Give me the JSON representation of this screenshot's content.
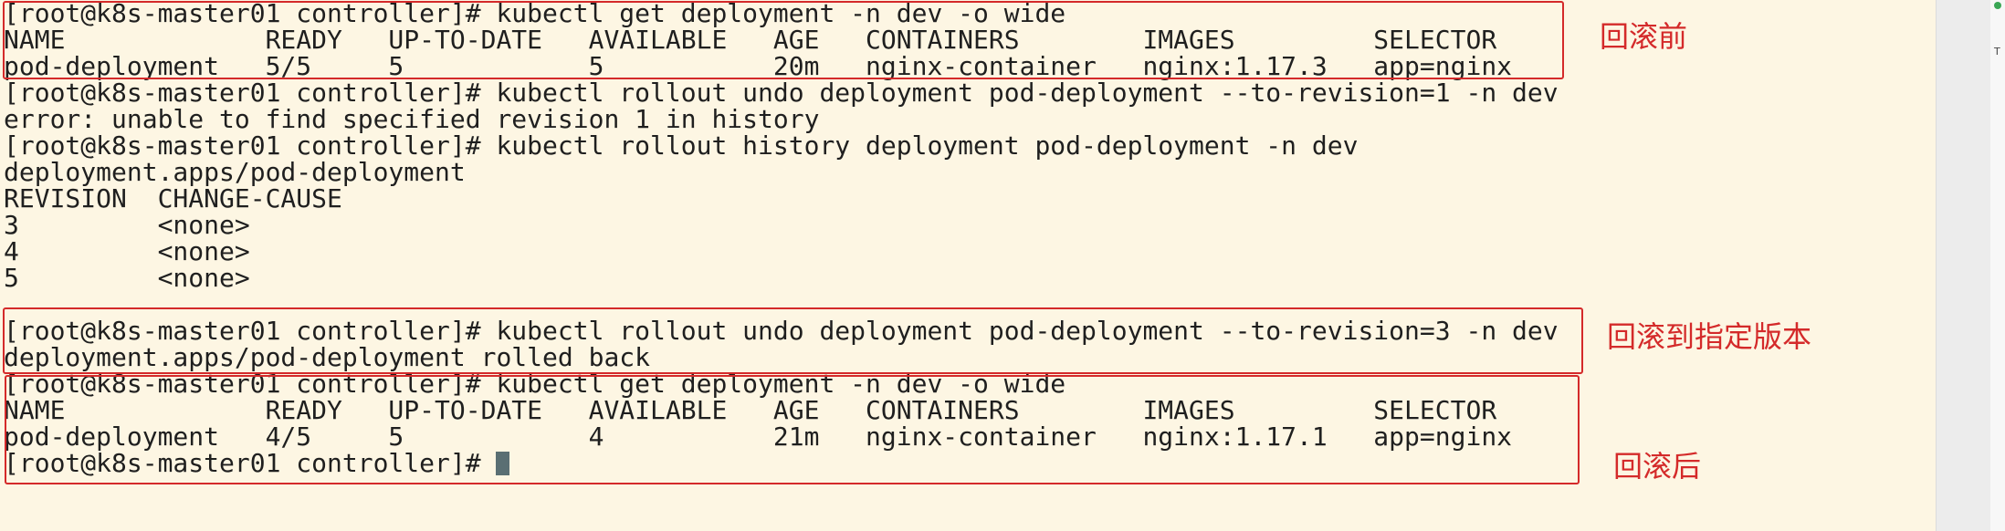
{
  "terminal": {
    "lines": [
      "[root@k8s-master01 controller]# kubectl get deployment -n dev -o wide",
      "NAME             READY   UP-TO-DATE   AVAILABLE   AGE   CONTAINERS        IMAGES         SELECTOR",
      "pod-deployment   5/5     5            5           20m   nginx-container   nginx:1.17.3   app=nginx",
      "[root@k8s-master01 controller]# kubectl rollout undo deployment pod-deployment --to-revision=1 -n dev",
      "error: unable to find specified revision 1 in history",
      "[root@k8s-master01 controller]# kubectl rollout history deployment pod-deployment -n dev",
      "deployment.apps/pod-deployment",
      "REVISION  CHANGE-CAUSE",
      "3         <none>",
      "4         <none>",
      "5         <none>",
      "",
      "[root@k8s-master01 controller]# kubectl rollout undo deployment pod-deployment --to-revision=3 -n dev",
      "deployment.apps/pod-deployment rolled back",
      "[root@k8s-master01 controller]# kubectl get deployment -n dev -o wide",
      "NAME             READY   UP-TO-DATE   AVAILABLE   AGE   CONTAINERS        IMAGES         SELECTOR",
      "pod-deployment   4/5     5            4           21m   nginx-container   nginx:1.17.1   app=nginx",
      "[root@k8s-master01 controller]# "
    ]
  },
  "annotations": {
    "before": "回滚前",
    "to_revision": "回滚到指定版本",
    "after": "回滚后"
  },
  "side": {
    "mark": "T"
  },
  "colors": {
    "background": "#fdf6e3",
    "text": "#1f1f1f",
    "annotation": "#d42a2a",
    "cursor": "#5a6f73"
  }
}
